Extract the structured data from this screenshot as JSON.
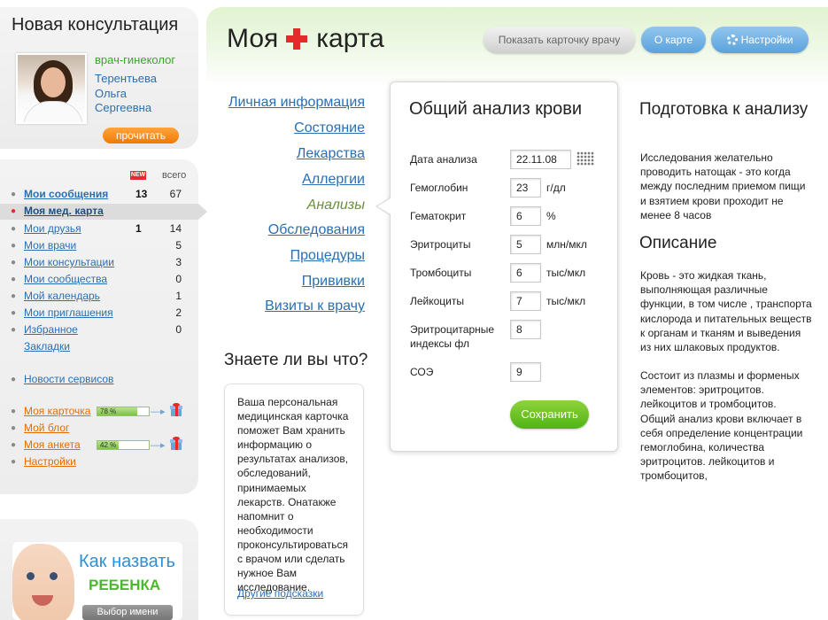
{
  "consult": {
    "title": "Новая консультация",
    "close": "×",
    "doctor_specialty": "врач-гинеколог",
    "doctor_name": "Терентьева Ольга Сергеевна",
    "read_button": "прочитать"
  },
  "menu": {
    "head_new": "NEW",
    "head_all": "всего",
    "items": [
      {
        "label": "Мои сообщения",
        "new": "13",
        "all": "67"
      },
      {
        "label": "Моя мед. карта",
        "new": "",
        "all": ""
      },
      {
        "label": "Мои друзья",
        "new": "1",
        "all": "14"
      },
      {
        "label": "Мои врачи",
        "new": "",
        "all": "5"
      },
      {
        "label": "Мои консультации",
        "new": "",
        "all": "3"
      },
      {
        "label": "Мои сообщества",
        "new": "",
        "all": "0"
      },
      {
        "label": "Мой календарь",
        "new": "",
        "all": "1"
      },
      {
        "label": "Мои приглашения",
        "new": "",
        "all": "2"
      },
      {
        "label": "Избранное",
        "new": "",
        "all": "0"
      }
    ],
    "bookmarks": "Закладки",
    "news": "Новости сервисов",
    "profile_items": [
      {
        "label": "Моя карточка",
        "progress_label": "78 %",
        "progress": 0.78
      },
      {
        "label": "Мой блог"
      },
      {
        "label": "Моя анкета",
        "progress_label": "42 %",
        "progress": 0.42
      },
      {
        "label": "Настройки"
      }
    ]
  },
  "baby_promo": {
    "title": "Как назвать",
    "subtitle": "РЕБЕНКА",
    "button": "Выбор имени"
  },
  "header": {
    "title_left": "Моя",
    "title_right": "карта",
    "show_card_button": "Показать карточку врачу",
    "about_button": "О карте",
    "settings_button": "Настройки"
  },
  "sections": [
    "Личная информация",
    "Состояние",
    "Лекарства",
    "Аллергии",
    "Анализы",
    "Обследования",
    "Процедуры",
    "Прививки",
    "Визиты к врачу"
  ],
  "current_section": "Анализы",
  "tip": {
    "title": "Знаете ли вы что?",
    "text": "Ваша персональная медицинская карточка поможет Вам хранить информацию о результатах анализов, обследований, принимаемых лекарств. Онатакже напомнит о необходимости проконсультироваться с врачом или сделать нужное Вам исследование.",
    "link": "Другие подсказки"
  },
  "form": {
    "title": "Общий анализ крови",
    "fields": [
      {
        "label": "Дата анализа",
        "value": "22.11.08",
        "unit": ""
      },
      {
        "label": "Гемоглобин",
        "value": "23",
        "unit": "г/дл"
      },
      {
        "label": "Гематокрит",
        "value": "6",
        "unit": "%"
      },
      {
        "label": "Эритроциты",
        "value": "5",
        "unit": "млн/мкл"
      },
      {
        "label": "Тромбоциты",
        "value": "6",
        "unit": "тыс/мкл"
      },
      {
        "label": "Лейкоциты",
        "value": "7",
        "unit": "тыс/мкл"
      },
      {
        "label": "Эритроцитарные индексы фл",
        "value": "8",
        "unit": ""
      },
      {
        "label": "СОЭ",
        "value": "9",
        "unit": ""
      }
    ],
    "save_button": "Сохранить"
  },
  "prep": {
    "title": "Подготовка к анализу",
    "text": "Исследования желательно проводить натощак - это когда между последним приемом пищи и взятием крови проходит не менее 8 часов"
  },
  "description": {
    "title": "Описание",
    "text1": "Кровь - это жидкая ткань, выполняющая различные функции, в том числе , транспорта кислорода и питательных веществ к органам и тканям и выведения из них шлаковых продуктов.",
    "text2": "Состоит из плазмы и форменых элементов: эритроцитов. лейкоцитов и тромбоцитов. Общий анализ крови включает в себя определение концентрации гемоглобина, количества эритроцитов. лейкоцитов и тромбоцитов,"
  }
}
